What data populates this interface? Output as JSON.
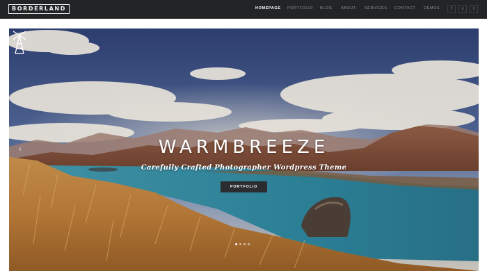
{
  "brand": {
    "logo_text": "BORDERLAND"
  },
  "nav": {
    "items": [
      {
        "label": "HOMEPAGE",
        "active": true
      },
      {
        "label": "PORTFOLIO",
        "active": false
      },
      {
        "label": "BLOG",
        "active": false
      },
      {
        "label": "ABOUT",
        "active": false
      },
      {
        "label": "SERVICES",
        "active": false
      },
      {
        "label": "CONTACT",
        "active": false
      },
      {
        "label": "DEMOS",
        "active": false
      }
    ],
    "social": [
      {
        "icon": "facebook-icon",
        "glyph": "f"
      },
      {
        "icon": "twitter-icon",
        "glyph": "v"
      },
      {
        "icon": "tumblr-icon",
        "glyph": "t"
      }
    ]
  },
  "hero": {
    "title": "WARMBREEZE",
    "subtitle": "Carefully Crafted Photographer Wordpress Theme",
    "button_label": "PORTFOLIO",
    "prev_glyph": "‹",
    "slide_count": 4,
    "active_slide": 1
  },
  "colors": {
    "topbar": "#222426",
    "nav_active": "#ffffff",
    "nav_inactive": "#8e9193",
    "button_bg": "#2a2c2e"
  }
}
